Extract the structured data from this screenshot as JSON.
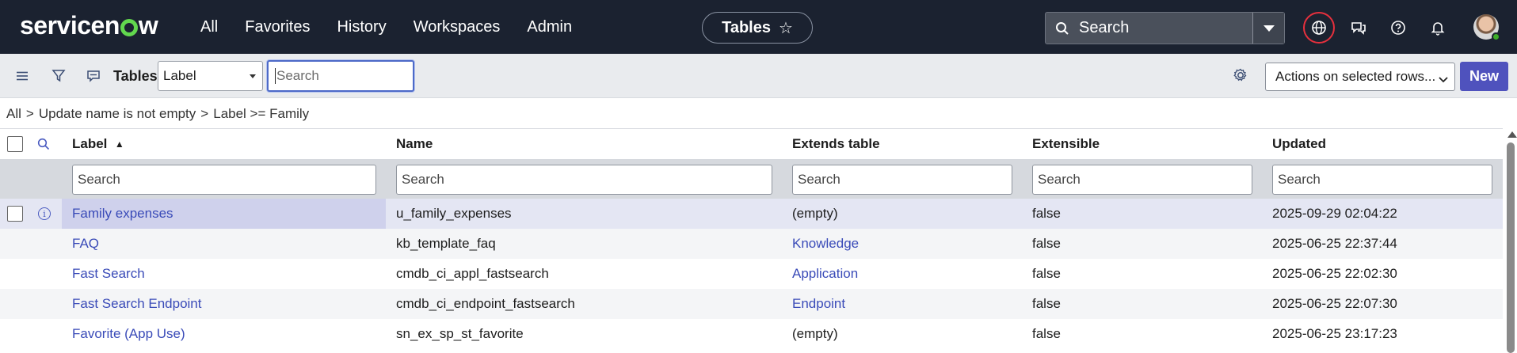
{
  "topnav": {
    "logo_text_1": "servicen",
    "logo_text_2": "w",
    "menu": [
      "All",
      "Favorites",
      "History",
      "Workspaces",
      "Admin"
    ],
    "context_pill": "Tables",
    "search_placeholder": "Search",
    "icons": [
      "globe-icon",
      "chat-icon",
      "help-icon",
      "bell-icon",
      "avatar"
    ]
  },
  "toolbar": {
    "title": "Tables",
    "filter_field": "Label",
    "search_placeholder": "Search",
    "actions_label": "Actions on selected rows...",
    "new_label": "New"
  },
  "breadcrumb": [
    "All",
    "Update name is not empty",
    "Label >= Family"
  ],
  "table": {
    "columns": [
      "Label",
      "Name",
      "Extends table",
      "Extensible",
      "Updated"
    ],
    "sort_indicator": "▲",
    "filter_placeholder": "Search",
    "rows": [
      {
        "label": "Family expenses",
        "name": "u_family_expenses",
        "extends": "(empty)",
        "extends_link": false,
        "extensible": "false",
        "updated": "2025-09-29 02:04:22"
      },
      {
        "label": "FAQ",
        "name": "kb_template_faq",
        "extends": "Knowledge",
        "extends_link": true,
        "extensible": "false",
        "updated": "2025-06-25 22:37:44"
      },
      {
        "label": "Fast Search",
        "name": "cmdb_ci_appl_fastsearch",
        "extends": "Application",
        "extends_link": true,
        "extensible": "false",
        "updated": "2025-06-25 22:02:30"
      },
      {
        "label": "Fast Search Endpoint",
        "name": "cmdb_ci_endpoint_fastsearch",
        "extends": "Endpoint",
        "extends_link": true,
        "extensible": "false",
        "updated": "2025-06-25 22:07:30"
      },
      {
        "label": "Favorite (App Use)",
        "name": "sn_ex_sp_st_favorite",
        "extends": "(empty)",
        "extends_link": false,
        "extensible": "false",
        "updated": "2025-06-25 23:17:23"
      }
    ]
  }
}
